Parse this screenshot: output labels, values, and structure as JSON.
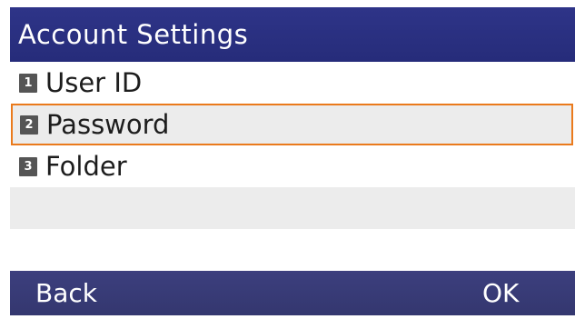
{
  "header": {
    "title": "Account Settings"
  },
  "menu": {
    "items": [
      {
        "number": "1",
        "label": "User ID",
        "selected": false
      },
      {
        "number": "2",
        "label": "Password",
        "selected": true
      },
      {
        "number": "3",
        "label": "Folder",
        "selected": false
      }
    ]
  },
  "softkeys": {
    "left": "Back",
    "right": "OK"
  },
  "colors": {
    "title_bar": "#2e3488",
    "softkey_bar": "#3c3f7e",
    "selection_border": "#ea7a1c",
    "alt_row": "#ececec"
  }
}
